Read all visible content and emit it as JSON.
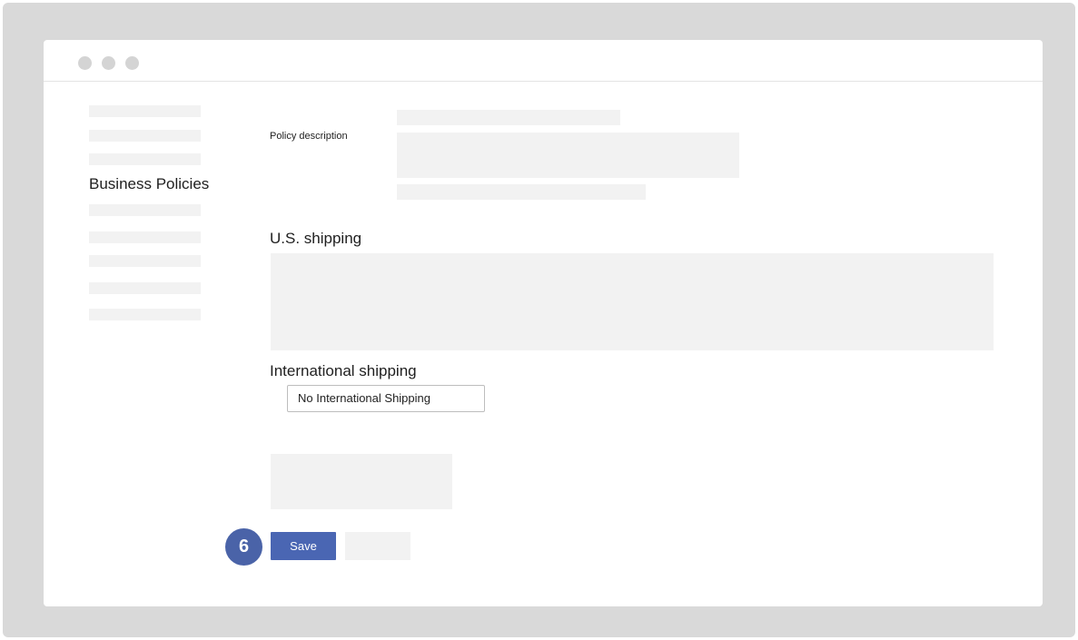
{
  "sidebar": {
    "active_item_label": "Business Policies"
  },
  "form": {
    "policy_description_label": "Policy description",
    "us_shipping_heading": "U.S. shipping",
    "international_shipping_heading": "International shipping",
    "international_shipping_value": "No International Shipping"
  },
  "actions": {
    "step_number": "6",
    "save_label": "Save"
  },
  "colors": {
    "primary_button": "#4a66b3",
    "step_badge": "#4a63a8",
    "placeholder": "#f2f2f2",
    "frame": "#d9d9d9"
  }
}
